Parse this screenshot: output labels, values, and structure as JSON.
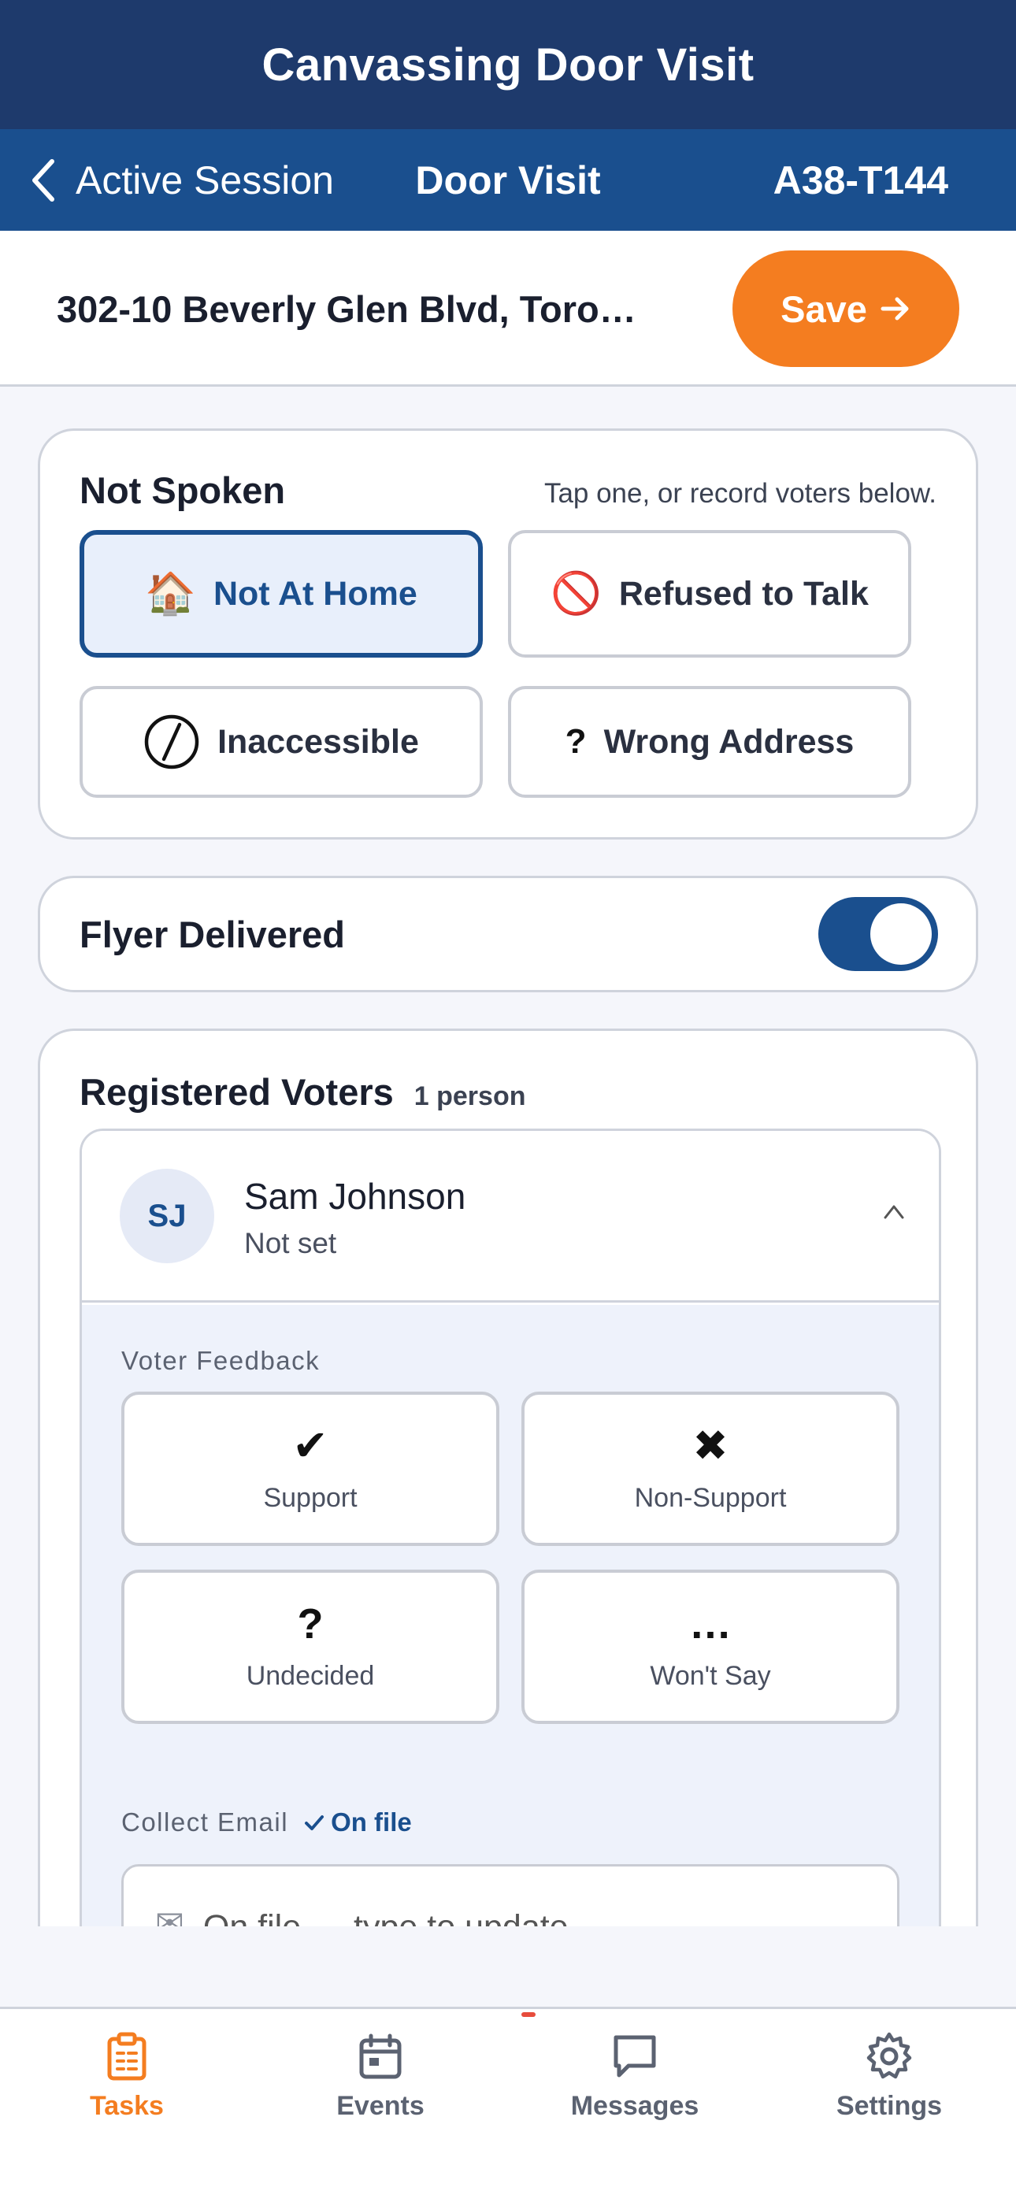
{
  "app": {
    "title": "Canvassing Door Visit"
  },
  "nav": {
    "back_label": "Active Session",
    "title": "Door Visit",
    "code": "A38-T144"
  },
  "address": {
    "text": "302-10 Beverly Glen Blvd, Toro…",
    "save_label": "Save"
  },
  "not_spoken": {
    "heading": "Not Spoken",
    "hint": "Tap one, or record voters below.",
    "options": [
      {
        "icon": "🏠",
        "label": "Not At Home",
        "selected": true
      },
      {
        "icon": "🚫",
        "label": "Refused to Talk",
        "selected": false
      },
      {
        "icon": "⊘",
        "label": "Inaccessible",
        "selected": false
      },
      {
        "icon": "?",
        "label": "Wrong Address",
        "selected": false
      }
    ]
  },
  "flyer": {
    "label": "Flyer Delivered",
    "on": true
  },
  "voters": {
    "heading": "Registered Voters",
    "count": "1 person",
    "items": [
      {
        "initials": "SJ",
        "name": "Sam Johnson",
        "status": "Not set",
        "feedback_label": "Voter Feedback",
        "feedback": [
          {
            "glyph": "✔",
            "label": "Support"
          },
          {
            "glyph": "✖",
            "label": "Non-Support"
          },
          {
            "glyph": "?",
            "label": "Undecided"
          },
          {
            "glyph": "…",
            "label": "Won't Say"
          }
        ],
        "collect_email_label": "Collect Email",
        "on_file_label": "On file",
        "email_placeholder": "On file — type to update"
      }
    ]
  },
  "tabs": [
    {
      "label": "Tasks",
      "active": true
    },
    {
      "label": "Events",
      "active": false
    },
    {
      "label": "Messages",
      "active": false
    },
    {
      "label": "Settings",
      "active": false
    }
  ],
  "colors": {
    "header": "#1e3a6c",
    "nav": "#1a4f8e",
    "accent": "#f47d20",
    "primary": "#1a4f8e"
  }
}
